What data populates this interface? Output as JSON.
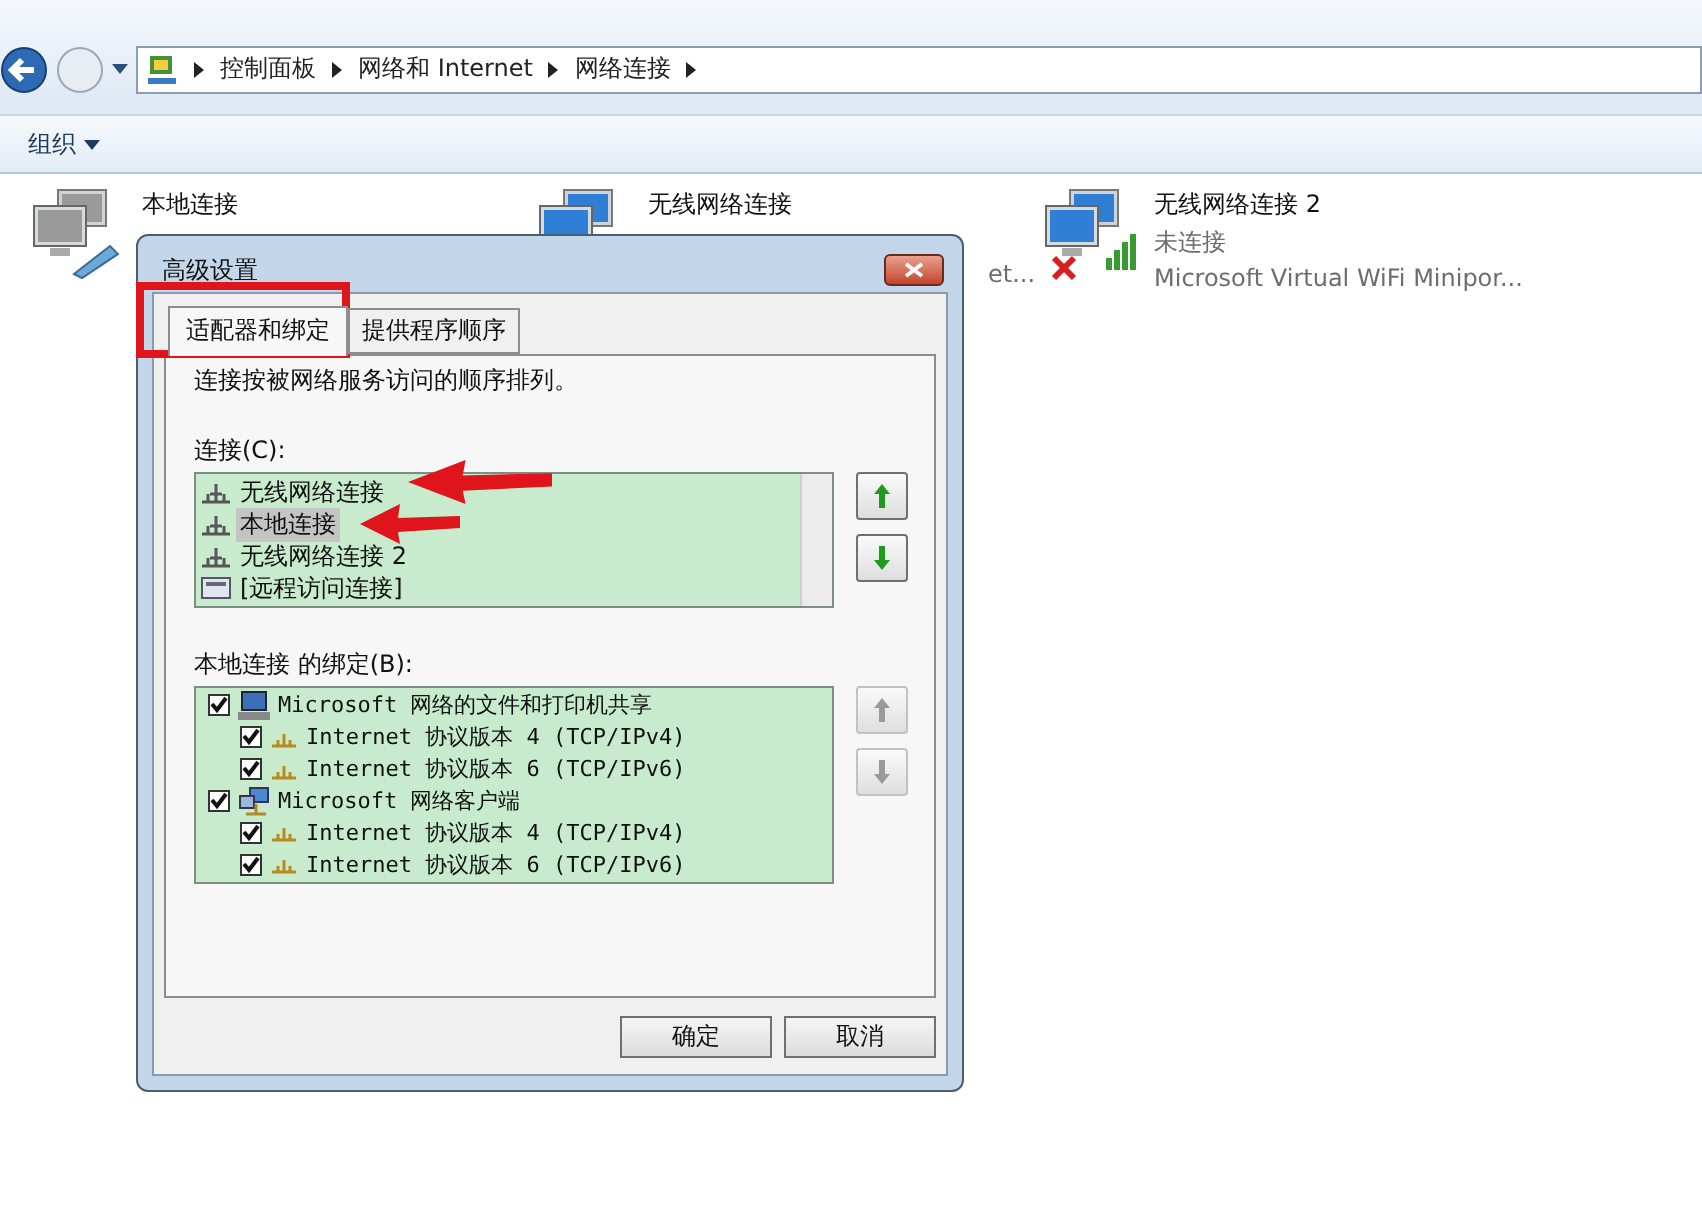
{
  "address_bar": {
    "crumbs": [
      "控制面板",
      "网络和 Internet",
      "网络连接"
    ]
  },
  "toolbar": {
    "organize": "组织"
  },
  "connections": [
    {
      "name": "本地连接",
      "kind": "wired"
    },
    {
      "name": "无线网络连接",
      "kind": "wireless",
      "detail": "et..."
    },
    {
      "name": "无线网络连接 2",
      "kind": "wireless",
      "status": "未连接",
      "detail": "Microsoft Virtual WiFi Minipor...",
      "disconnected": true,
      "signal": true
    }
  ],
  "dialog": {
    "title": "高级设置",
    "tabs": [
      {
        "label": "适配器和绑定",
        "selected": true
      },
      {
        "label": "提供程序顺序",
        "selected": false
      }
    ],
    "description": "连接按被网络服务访问的顺序排列。",
    "connections_label": "连接(C):",
    "connection_list": [
      {
        "label": "无线网络连接",
        "kind": "network",
        "selected": false
      },
      {
        "label": "本地连接",
        "kind": "network",
        "selected": true
      },
      {
        "label": "无线网络连接 2",
        "kind": "network",
        "selected": false
      },
      {
        "label": "[远程访问连接]",
        "kind": "remote",
        "selected": false
      }
    ],
    "connection_moves": [
      {
        "kind": "up",
        "disabled": false
      },
      {
        "kind": "down",
        "disabled": false
      }
    ],
    "bindings_label": "本地连接 的绑定(B):",
    "bindings": [
      {
        "label": "Microsoft 网络的文件和打印机共享",
        "kind": "share",
        "checked": true,
        "children": [
          {
            "label": "Internet 协议版本 4 (TCP/IPv4)",
            "kind": "protocol",
            "checked": true
          },
          {
            "label": "Internet 协议版本 6 (TCP/IPv6)",
            "kind": "protocol",
            "checked": true
          }
        ]
      },
      {
        "label": "Microsoft 网络客户端",
        "kind": "client",
        "checked": true,
        "children": [
          {
            "label": "Internet 协议版本 4 (TCP/IPv4)",
            "kind": "protocol",
            "checked": true
          },
          {
            "label": "Internet 协议版本 6 (TCP/IPv6)",
            "kind": "protocol",
            "checked": true
          }
        ]
      }
    ],
    "binding_moves": [
      {
        "kind": "up",
        "disabled": true
      },
      {
        "kind": "down",
        "disabled": true
      }
    ],
    "buttons": [
      {
        "label": "确定"
      },
      {
        "label": "取消"
      }
    ]
  },
  "annotations": [
    {
      "kind": "frame"
    },
    {
      "kind": "arrow"
    },
    {
      "kind": "arrow"
    }
  ]
}
